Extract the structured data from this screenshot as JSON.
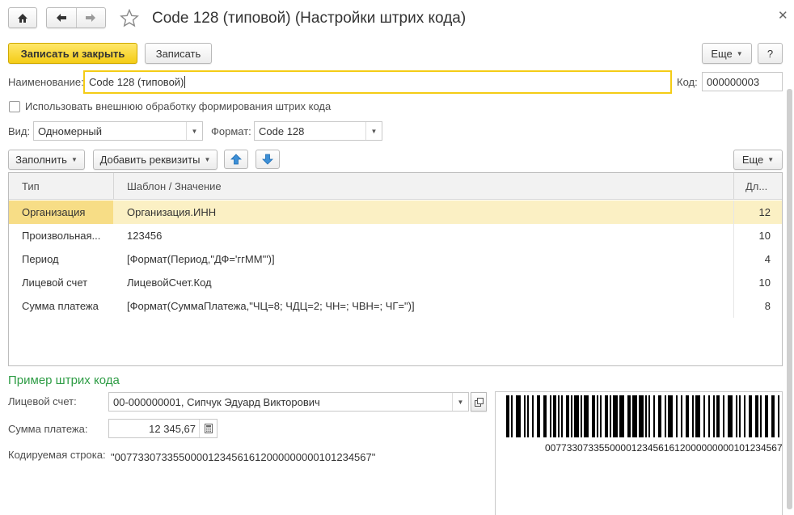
{
  "header": {
    "title": "Code 128 (типовой) (Настройки штрих кода)"
  },
  "toolbar": {
    "save_close_label": "Записать и закрыть",
    "save_label": "Записать",
    "more_label": "Еще",
    "help_label": "?"
  },
  "form": {
    "name_label": "Наименование:",
    "name_value": "Code 128 (типовой)",
    "code_label": "Код:",
    "code_value": "000000003",
    "external_checkbox_label": "Использовать внешнюю обработку формирования штрих кода",
    "external_checked": false,
    "kind_label": "Вид:",
    "kind_value": "Одномерный",
    "format_label": "Формат:",
    "format_value": "Code 128"
  },
  "table_toolbar": {
    "fill_label": "Заполнить",
    "add_attrs_label": "Добавить реквизиты",
    "more_label": "Еще"
  },
  "table": {
    "columns": [
      "Тип",
      "Шаблон / Значение",
      "Дл..."
    ],
    "rows": [
      {
        "type": "Организация",
        "template": "Организация.ИНН",
        "length": "12"
      },
      {
        "type": "Произвольная...",
        "template": "123456",
        "length": "10"
      },
      {
        "type": "Период",
        "template": "[Формат(Период,\"ДФ='ггММ'\")]",
        "length": "4"
      },
      {
        "type": "Лицевой счет",
        "template": "ЛицевойСчет.Код",
        "length": "10"
      },
      {
        "type": "Сумма платежа",
        "template": "[Формат(СуммаПлатежа,\"ЧЦ=8; ЧДЦ=2; ЧН=; ЧВН=; ЧГ=\")]",
        "length": "8"
      }
    ]
  },
  "example": {
    "section_title": "Пример штрих кода",
    "account_label": "Лицевой счет:",
    "account_value": "00-000000001, Сипчук Эдуард Викторович",
    "sum_label": "Сумма платежа:",
    "sum_value": "12 345,67",
    "encoded_label": "Кодируемая строка:",
    "encoded_value": "\"00773307335500001234561612000000000101234567\"",
    "barcode_text": "00773307335500001234561612000000000101234567"
  },
  "colors": {
    "accent_yellow": "#f4cc16",
    "selected_row": "#fbf0c4",
    "section_green": "#2e9c45",
    "arrow_blue": "#3d8fd6"
  }
}
